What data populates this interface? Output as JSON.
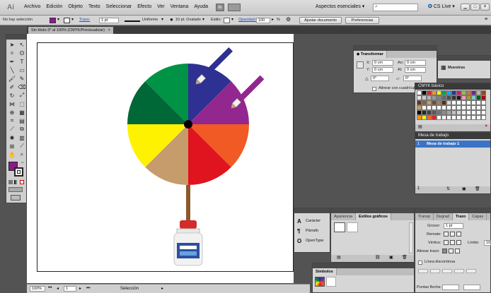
{
  "menubar": {
    "logo": "Ai",
    "items": [
      "Archivo",
      "Edición",
      "Objeto",
      "Texto",
      "Seleccionar",
      "Efecto",
      "Ver",
      "Ventana",
      "Ayuda"
    ],
    "workspace": "Aspectos esenciales",
    "cslive": "CS Live"
  },
  "control": {
    "selection": "No hay selección",
    "stroke_label": "Trazo:",
    "stroke_value": "1 pt",
    "profile": "Uniforme",
    "brush": "10 pt. Ovalado",
    "style_label": "Estilo:",
    "opacity_label": "Opacidad:",
    "opacity_value": "100",
    "percent": "%",
    "adjust_button": "Ajustar documento",
    "prefs_button": "Preferencias"
  },
  "document": {
    "tab_title": "Sin título-3* al 100% (CMYK/Previsualizar)",
    "close": "×"
  },
  "statusbar": {
    "zoom": "100%",
    "page": "1",
    "status": "Selección"
  },
  "transform": {
    "title": "Transformar",
    "x_label": "X:",
    "x_value": "0 cm",
    "w_label": "An:",
    "w_value": "0 cm",
    "y_label": "Y:",
    "y_value": "0 cm",
    "h_label": "Al:",
    "h_value": "0 cm",
    "angle": "0°",
    "shear": "0°",
    "align_label": "Alinear con cuadrícula"
  },
  "muestras": {
    "label": "Muestras"
  },
  "cmyk": {
    "title": "CMYK básico",
    "colors": [
      "#ffffff",
      "#000000",
      "#ed1c24",
      "#f7941d",
      "#fff200",
      "#00a651",
      "#00aeef",
      "#2e3192",
      "#ec008c",
      "#8dc63f",
      "#f26522",
      "#662d91",
      "#c2b59b",
      "#a0410d",
      "#e6e6e6",
      "#cccccc",
      "#b3b3b3",
      "#999999",
      "#808080",
      "#666666",
      "#4d4d4d",
      "#333333",
      "#1a1a1a",
      "#f49ac2",
      "#aba000",
      "#7accc8",
      "#005e20",
      "#9e0b0f",
      "#603913",
      "#8c6239",
      "#c69c6d",
      "#754c24",
      "#a67c52",
      "#5c2d0e",
      "#d7d7d7",
      "#ffffff",
      "#ffffff",
      "#ffffff",
      "#ffffff",
      "#ffffff",
      "#ffffff",
      "#ffffff",
      "#cc9966",
      "#ffffff",
      "#ffffff",
      "#ffffff",
      "#ffffff",
      "#ffffff",
      "#ffffff",
      "#ffffff",
      "#ffffff",
      "#ffffff",
      "#ffffff",
      "#ffffff",
      "#ffffff",
      "#ffffff",
      "#000000",
      "#262626",
      "#404040",
      "#595959",
      "#737373",
      "#8c8c8c",
      "#a6a6a6",
      "#bfbfbf",
      "#d9d9d9",
      "#f2f2f2",
      "#ffffff",
      "#ffffff",
      "#ffffff",
      "#ffffff",
      "#f7941d",
      "#fff200",
      "#f26522",
      "#ed1c24",
      "#ffffff",
      "#ffffff",
      "#ffffff",
      "#ffffff",
      "#ffffff",
      "#ffffff",
      "#ffffff",
      "#ffffff",
      "#ffffff",
      "#ffffff"
    ]
  },
  "artboards": {
    "title": "Mesa de trabajo",
    "row_num": "1",
    "row_name": "Mesa de trabajo 1",
    "footer_num": "1"
  },
  "charpanel": {
    "items": [
      "Carácter",
      "Párrafo",
      "OpenType"
    ]
  },
  "apariencia": {
    "tabs": [
      "Apariencia",
      "Estilos gráficos"
    ]
  },
  "trazo": {
    "tabs": [
      "Transp",
      "Degrad",
      "Trazo",
      "Capas"
    ],
    "grosor_label": "Grosor:",
    "grosor_value": "1 pt",
    "remate_label": "Remate:",
    "vertice_label": "Vértice:",
    "limite_label": "Límite:",
    "limite_value": "10",
    "alinear_label": "Alinear trazo:",
    "discontinua_label": "Línea discontinua",
    "puntas_label": "Puntas flecha:"
  },
  "simbolos": {
    "title": "Símbolos"
  },
  "accent": {
    "fill": "#8b1a8b",
    "artboard_selected": "#3a74c6"
  }
}
